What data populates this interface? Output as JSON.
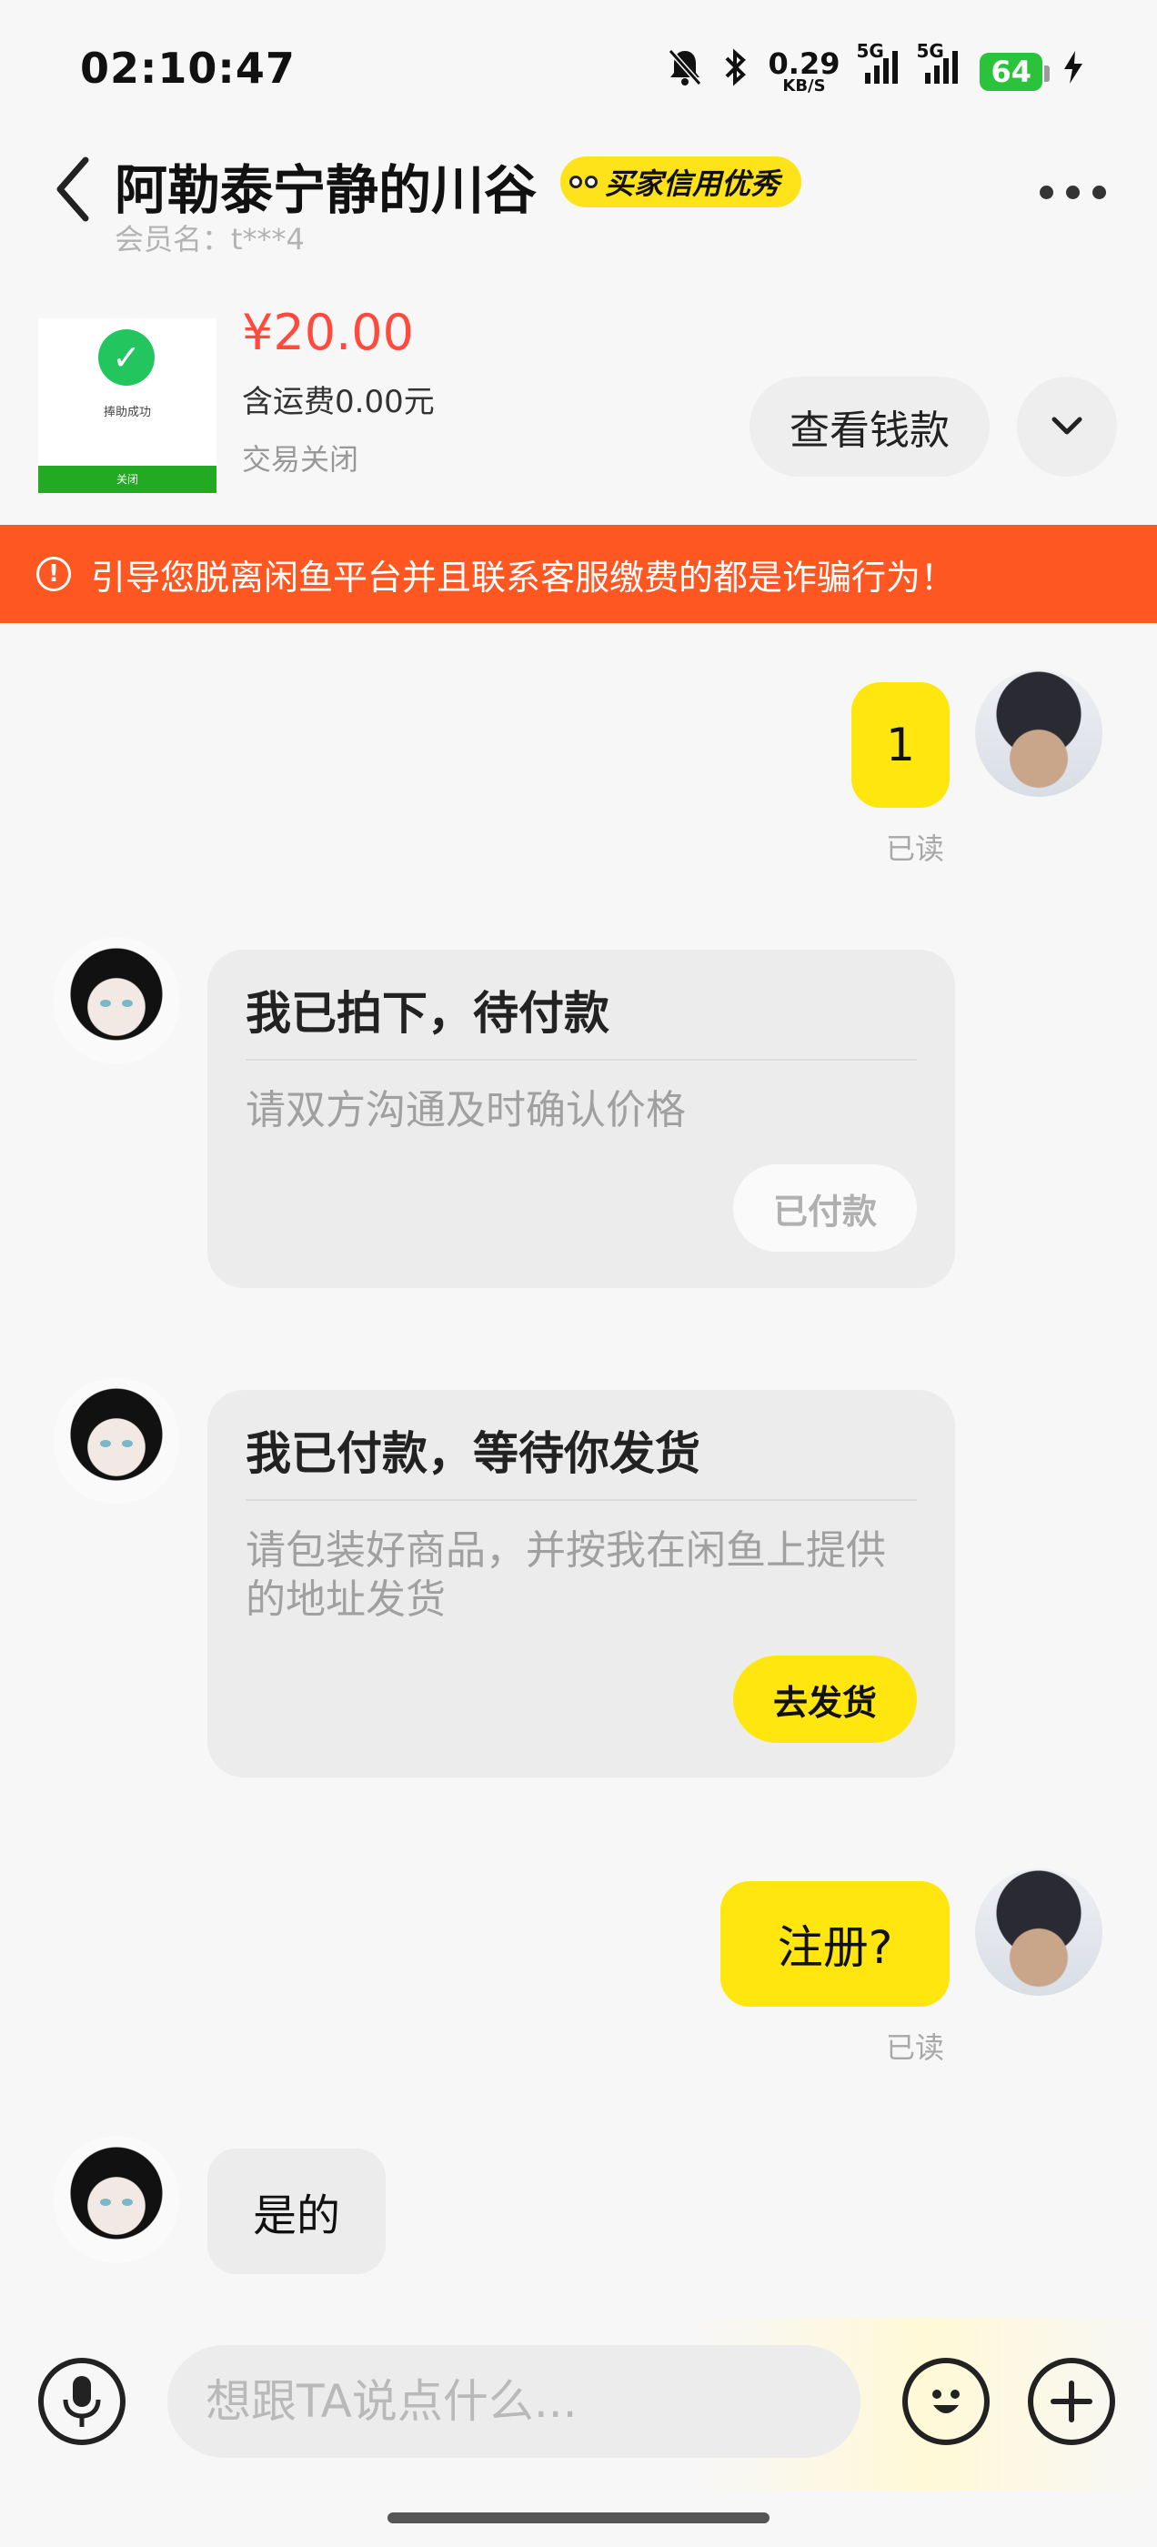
{
  "status_bar": {
    "time": "02:10:47",
    "net_speed_value": "0.29",
    "net_speed_unit": "KB/S",
    "sim1_label": "5G",
    "sim2_label": "5G",
    "battery": "64",
    "icons": [
      "mute-bell-icon",
      "bluetooth-icon",
      "signal-icon",
      "signal-icon",
      "battery-icon",
      "charging-bolt-icon"
    ]
  },
  "header": {
    "title": "阿勒泰宁静的川谷",
    "credit_badge": "买家信用优秀",
    "member_name": "会员名：t***4"
  },
  "product": {
    "thumb_caption": "捧助成功",
    "thumb_bar_label": "关闭",
    "price": "¥20.00",
    "shipping": "含运费0.00元",
    "status": "交易关闭",
    "view_money_label": "查看钱款"
  },
  "warning": {
    "text": "引导您脱离闲鱼平台并且联系客服缴费的都是诈骗行为！"
  },
  "messages": {
    "m1_text": "1",
    "m1_read": "已读",
    "card1": {
      "title": "我已拍下，待付款",
      "desc": "请双方沟通及时确认价格",
      "button": "已付款"
    },
    "card2": {
      "title": "我已付款，等待你发货",
      "desc": "请包装好商品，并按我在闲鱼上提供的地址发货",
      "button": "去发货"
    },
    "m2_text": "注册?",
    "m2_read": "已读",
    "m3_text": "是的"
  },
  "input": {
    "placeholder": "想跟TA说点什么..."
  },
  "colors": {
    "accent_yellow": "#ffe60f",
    "warning_orange": "#ff5722",
    "price_red": "#ff4a3d",
    "battery_green": "#2ac33b"
  }
}
